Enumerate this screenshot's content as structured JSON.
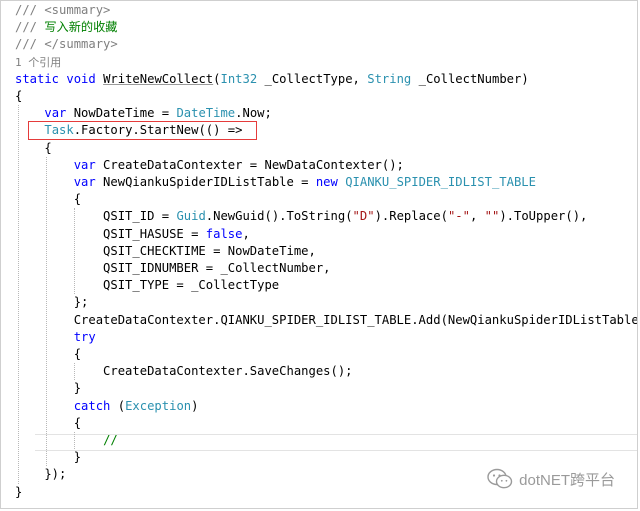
{
  "editor": {
    "lines": [
      [
        {
          "t": "/// <summary>",
          "c": "xml"
        }
      ],
      [
        {
          "t": "/// ",
          "c": "xml"
        },
        {
          "t": "写入新的收藏",
          "c": "cm"
        }
      ],
      [
        {
          "t": "/// </summary>",
          "c": "xml"
        }
      ],
      [
        {
          "t": "1 个引用",
          "c": "lens"
        }
      ],
      [
        {
          "t": "static",
          "c": "kw"
        },
        {
          "t": " "
        },
        {
          "t": "void",
          "c": "kw"
        },
        {
          "t": " "
        },
        {
          "t": "WriteNewCollect",
          "c": "uline"
        },
        {
          "t": "("
        },
        {
          "t": "Int32",
          "c": "type"
        },
        {
          "t": " _CollectType, "
        },
        {
          "t": "String",
          "c": "type"
        },
        {
          "t": " _CollectNumber)"
        }
      ],
      [
        {
          "t": "{"
        }
      ],
      [
        {
          "t": "    "
        },
        {
          "t": "var",
          "c": "kw"
        },
        {
          "t": " NowDateTime = "
        },
        {
          "t": "DateTime",
          "c": "type"
        },
        {
          "t": ".Now;"
        }
      ],
      [
        {
          "t": "    "
        },
        {
          "t": "Task",
          "c": "type"
        },
        {
          "t": ".Factory.StartNew(() =>"
        }
      ],
      [
        {
          "t": "    {"
        }
      ],
      [
        {
          "t": "        "
        },
        {
          "t": "var",
          "c": "kw"
        },
        {
          "t": " CreateDataContexter = NewDataContexter();"
        }
      ],
      [
        {
          "t": "        "
        },
        {
          "t": "var",
          "c": "kw"
        },
        {
          "t": " NewQiankuSpiderIDListTable = "
        },
        {
          "t": "new",
          "c": "kw"
        },
        {
          "t": " "
        },
        {
          "t": "QIANKU_SPIDER_IDLIST_TABLE",
          "c": "type"
        }
      ],
      [
        {
          "t": "        {"
        }
      ],
      [
        {
          "t": "            QSIT_ID = "
        },
        {
          "t": "Guid",
          "c": "type"
        },
        {
          "t": ".NewGuid().ToString("
        },
        {
          "t": "\"D\"",
          "c": "str"
        },
        {
          "t": ").Replace("
        },
        {
          "t": "\"-\"",
          "c": "str"
        },
        {
          "t": ", "
        },
        {
          "t": "\"\"",
          "c": "str"
        },
        {
          "t": ").ToUpper(),"
        }
      ],
      [
        {
          "t": "            QSIT_HASUSE = "
        },
        {
          "t": "false",
          "c": "kw"
        },
        {
          "t": ","
        }
      ],
      [
        {
          "t": "            QSIT_CHECKTIME = NowDateTime,"
        }
      ],
      [
        {
          "t": "            QSIT_IDNUMBER = _CollectNumber,"
        }
      ],
      [
        {
          "t": "            QSIT_TYPE = _CollectType"
        }
      ],
      [
        {
          "t": "        };"
        }
      ],
      [
        {
          "t": "        CreateDataContexter.QIANKU_SPIDER_IDLIST_TABLE.Add(NewQiankuSpiderIDListTable);"
        }
      ],
      [
        {
          "t": "        "
        },
        {
          "t": "try",
          "c": "kw"
        }
      ],
      [
        {
          "t": "        {"
        }
      ],
      [
        {
          "t": "            CreateDataContexter.SaveChanges();"
        }
      ],
      [
        {
          "t": "        }"
        }
      ],
      [
        {
          "t": "        "
        },
        {
          "t": "catch",
          "c": "kw"
        },
        {
          "t": " ("
        },
        {
          "t": "Exception",
          "c": "type"
        },
        {
          "t": ")"
        }
      ],
      [
        {
          "t": "        {"
        }
      ],
      [
        {
          "t": "            "
        },
        {
          "t": "//",
          "c": "cm"
        }
      ],
      [
        {
          "t": "        }"
        }
      ],
      [
        {
          "t": "    });"
        }
      ],
      [
        {
          "t": "}"
        }
      ]
    ]
  },
  "watermark": {
    "text": "dotNET跨平台",
    "icon": "wechat-icon"
  },
  "colors": {
    "keyword": "#0000ff",
    "type": "#2b91af",
    "string": "#a31515",
    "comment": "#008000",
    "xml_doc": "#808080",
    "highlight_box": "#e53b3b"
  }
}
